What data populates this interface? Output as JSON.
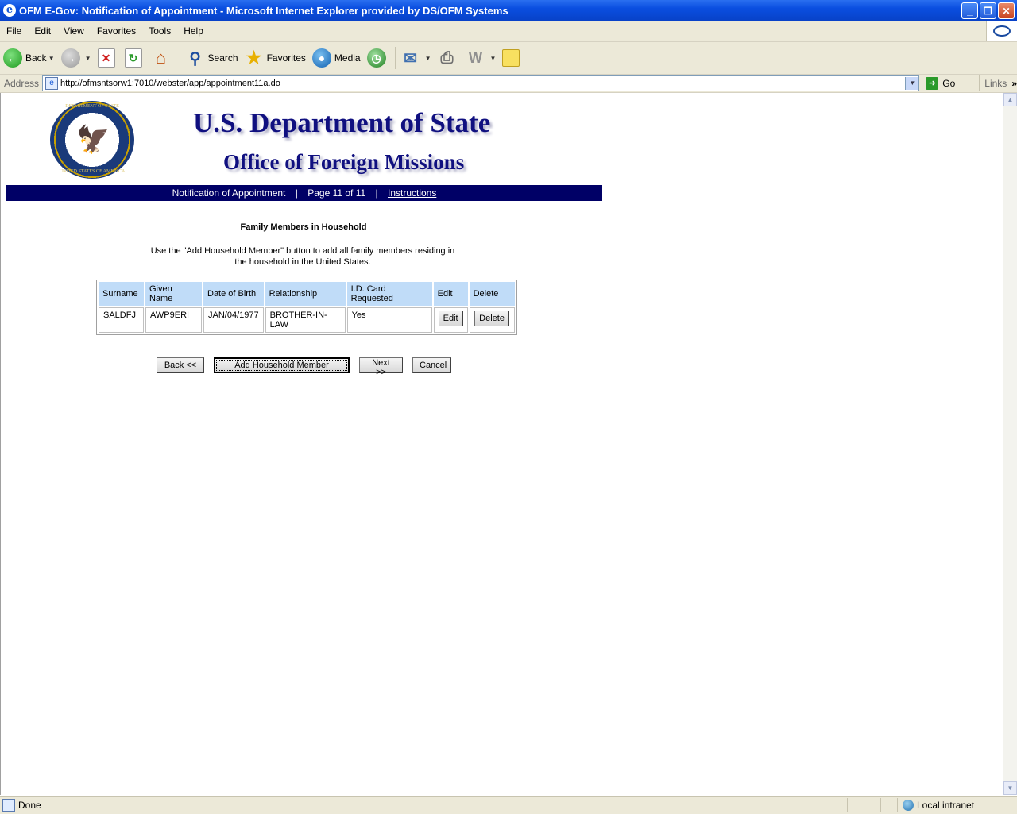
{
  "window": {
    "title": "OFM E-Gov: Notification of Appointment - Microsoft Internet Explorer provided by DS/OFM Systems",
    "minimize": "_",
    "maximize": "❐",
    "close": "✕"
  },
  "menu": [
    "File",
    "Edit",
    "View",
    "Favorites",
    "Tools",
    "Help"
  ],
  "toolbar": {
    "back": "Back",
    "search": "Search",
    "favorites": "Favorites",
    "media": "Media"
  },
  "address": {
    "label": "Address",
    "url": "http://ofmsntsorw1:7010/webster/app/appointment11a.do",
    "go": "Go",
    "links": "Links"
  },
  "header": {
    "title": "U.S. Department of State",
    "subtitle": "Office of Foreign Missions",
    "seal_top": "DEPARTMENT OF STATE",
    "seal_bottom": "UNITED STATES OF AMERICA"
  },
  "nav": {
    "form_name": "Notification of Appointment",
    "sep1": "|",
    "page": "Page 11 of 11",
    "sep2": "|",
    "instructions": "Instructions"
  },
  "section": {
    "title": "Family Members in Household",
    "instructions": "Use the \"Add Household Member\" button to add all family members residing in the household in the United States."
  },
  "table": {
    "headers": [
      "Surname",
      "Given Name",
      "Date of Birth",
      "Relationship",
      "I.D. Card Requested",
      "Edit",
      "Delete"
    ],
    "rows": [
      {
        "surname": "SALDFJ",
        "given_name": "AWP9ERI",
        "dob": "JAN/04/1977",
        "relationship": "BROTHER-IN-LAW",
        "id_card": "Yes",
        "edit": "Edit",
        "delete": "Delete"
      }
    ]
  },
  "buttons": {
    "back": "Back <<",
    "add": "Add Household Member",
    "next": "Next >>",
    "cancel": "Cancel"
  },
  "status": {
    "text": "Done",
    "zone": "Local intranet"
  }
}
